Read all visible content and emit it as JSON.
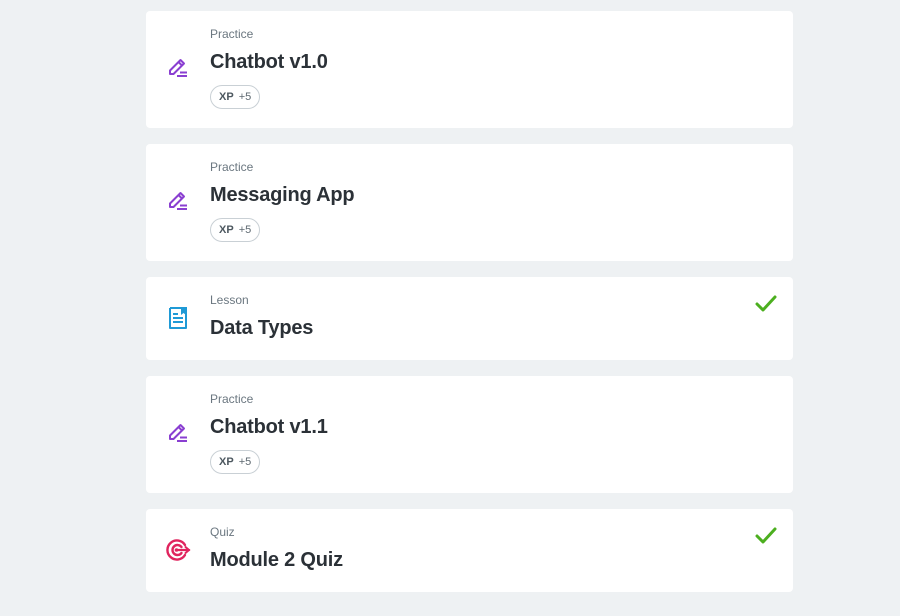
{
  "items": [
    {
      "kind": "Practice",
      "title": "Chatbot v1.0",
      "xp_label": "XP",
      "xp_value": "+5",
      "icon": "pencil-icon",
      "completed": false
    },
    {
      "kind": "Practice",
      "title": "Messaging App",
      "xp_label": "XP",
      "xp_value": "+5",
      "icon": "pencil-icon",
      "completed": false
    },
    {
      "kind": "Lesson",
      "title": "Data Types",
      "icon": "document-icon",
      "completed": true
    },
    {
      "kind": "Practice",
      "title": "Chatbot v1.1",
      "xp_label": "XP",
      "xp_value": "+5",
      "icon": "pencil-icon",
      "completed": false
    },
    {
      "kind": "Quiz",
      "title": "Module 2 Quiz",
      "icon": "target-icon",
      "completed": true
    }
  ],
  "colors": {
    "practice_icon": "#8a3fd1",
    "lesson_icon": "#1f9ad6",
    "quiz_icon": "#e0245e",
    "check": "#4caf1f"
  }
}
